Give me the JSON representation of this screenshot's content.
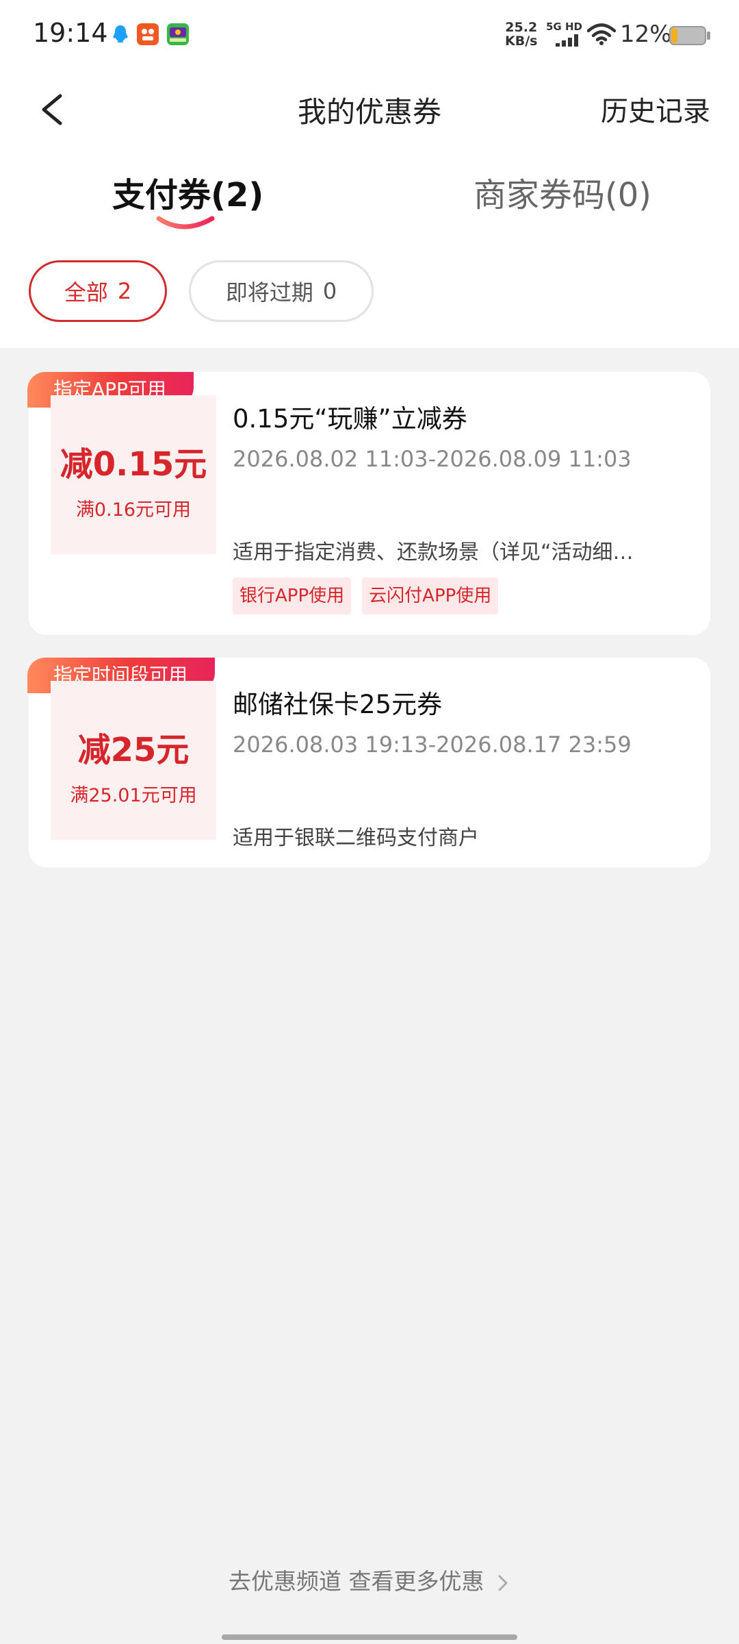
{
  "status_bar": {
    "time": "19:14",
    "net_speed_value": "25.2",
    "net_speed_unit": "KB/s",
    "network_label": "5G HD",
    "battery_percent": "12%",
    "battery_level": 0.12,
    "app_icons": [
      "qq-icon",
      "app-orange-icon",
      "app-green-icon"
    ]
  },
  "header": {
    "title": "我的优惠券",
    "history": "历史记录"
  },
  "tabs": [
    {
      "label": "支付券(2)",
      "active": true
    },
    {
      "label": "商家券码(0)",
      "active": false
    }
  ],
  "filters": [
    {
      "label": "全部",
      "count": "2",
      "active": true
    },
    {
      "label": "即将过期",
      "count": "0",
      "active": false
    }
  ],
  "coupons": [
    {
      "badge": "指定APP可用",
      "amount": "减0.15元",
      "condition": "满0.16元可用",
      "title": "0.15元“玩赚”立减券",
      "date": "2026.08.02 11:03-2026.08.09 11:03",
      "desc": "适用于指定消费、还款场景（详见“活动细…",
      "tags": [
        "银行APP使用",
        "云闪付APP使用"
      ]
    },
    {
      "badge": "指定时间段可用",
      "amount": "减25元",
      "condition": "满25.01元可用",
      "title": "邮储社保卡25元券",
      "date": "2026.08.03 19:13-2026.08.17 23:59",
      "desc": "适用于银联二维码支付商户"
    }
  ],
  "footer": {
    "more_link": "去优惠频道 查看更多优惠"
  },
  "colors": {
    "accent_red": "#d6262c",
    "chip_border": "#d12b2b",
    "tag_bg": "#fde9ea",
    "badge_gradient_start": "#ff8a5c",
    "badge_gradient_end": "#e8245a",
    "page_bg": "#f2f2f2"
  }
}
